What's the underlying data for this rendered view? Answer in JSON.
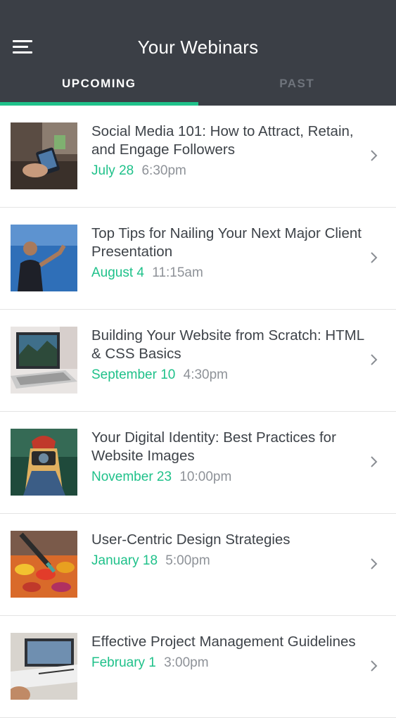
{
  "header": {
    "title": "Your Webinars",
    "tabs": [
      {
        "label": "UPCOMING",
        "active": true
      },
      {
        "label": "PAST",
        "active": false
      }
    ]
  },
  "colors": {
    "header_bg": "#3b3f46",
    "accent": "#1fc18a",
    "title_text": "#3e4349",
    "time_text": "#8e9298"
  },
  "webinars": [
    {
      "title": "Social Media 101: How to Attract, Retain, and Engage Followers",
      "date": "July 28",
      "time": "6:30pm",
      "thumb": "phone-photo"
    },
    {
      "title": "Top Tips for Nailing Your Next Major Client Presentation",
      "date": "August 4",
      "time": "11:15am",
      "thumb": "speaker-photo"
    },
    {
      "title": "Building Your Website from Scratch: HTML & CSS Basics",
      "date": "September 10",
      "time": "4:30pm",
      "thumb": "laptop-photo"
    },
    {
      "title": "Your Digital Identity: Best Practices for Website Images",
      "date": "November 23",
      "time": "10:00pm",
      "thumb": "camera-photo"
    },
    {
      "title": "User-Centric Design Strategies",
      "date": "January 18",
      "time": "5:00pm",
      "thumb": "paint-photo"
    },
    {
      "title": "Effective Project Management Guidelines",
      "date": "February 1",
      "time": "3:00pm",
      "thumb": "notebook-photo"
    }
  ]
}
